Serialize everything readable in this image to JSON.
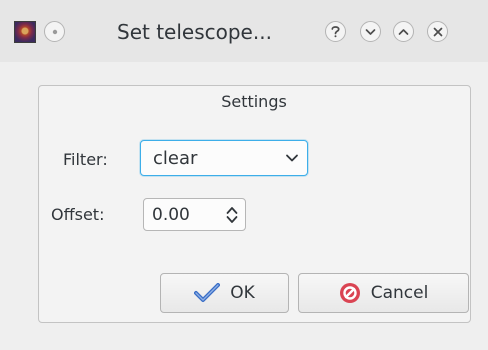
{
  "window": {
    "title": "Set telescope..."
  },
  "titlebar": {
    "app_icon": "telescope-app-icon",
    "pin_icon": "dot-icon",
    "help_icon": "question-mark-icon",
    "minimize_icon": "chevron-down-icon",
    "maximize_icon": "chevron-up-icon",
    "close_icon": "x-icon"
  },
  "settings": {
    "group_title": "Settings",
    "filter_label": "Filter:",
    "filter_value": "clear",
    "offset_label": "Offset:",
    "offset_value": "0.00"
  },
  "buttons": {
    "ok_label": "OK",
    "cancel_label": "Cancel"
  },
  "colors": {
    "accent": "#3daee9",
    "ok_icon": "#3a6ec6",
    "cancel_icon": "#da4453",
    "text": "#31363b"
  }
}
